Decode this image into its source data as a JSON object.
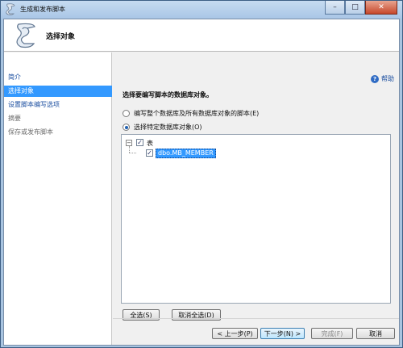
{
  "window": {
    "title": "生成和发布脚本",
    "controls": {
      "minimize": "–",
      "maximize": "□",
      "close": "✕"
    }
  },
  "header": {
    "title": "选择对象"
  },
  "sidebar": {
    "items": [
      {
        "label": "简介",
        "state": "link"
      },
      {
        "label": "选择对象",
        "state": "active"
      },
      {
        "label": "设置脚本编写选项",
        "state": "link"
      },
      {
        "label": "摘要",
        "state": "disabled"
      },
      {
        "label": "保存或发布脚本",
        "state": "disabled"
      }
    ]
  },
  "main": {
    "help_label": "帮助",
    "heading": "选择要编写脚本的数据库对象。",
    "options": [
      {
        "label": "编写整个数据库及所有数据库对象的脚本(E)",
        "selected": false
      },
      {
        "label": "选择特定数据库对象(O)",
        "selected": true
      }
    ],
    "tree": {
      "expander": "−",
      "root": {
        "label": "表",
        "checked": true
      },
      "children": [
        {
          "label": "dbo.MB_MEMBER",
          "checked": true
        }
      ]
    },
    "select_all_label": "全选(S)",
    "deselect_all_label": "取消全选(D)"
  },
  "footer": {
    "prev_label": "< 上一步(P)",
    "next_label": "下一步(N) >",
    "finish_label": "完成(F)",
    "cancel_label": "取消"
  },
  "colors": {
    "accent": "#3399ff",
    "link": "#1c4fa0",
    "titlebar": "#b9d1ea"
  }
}
